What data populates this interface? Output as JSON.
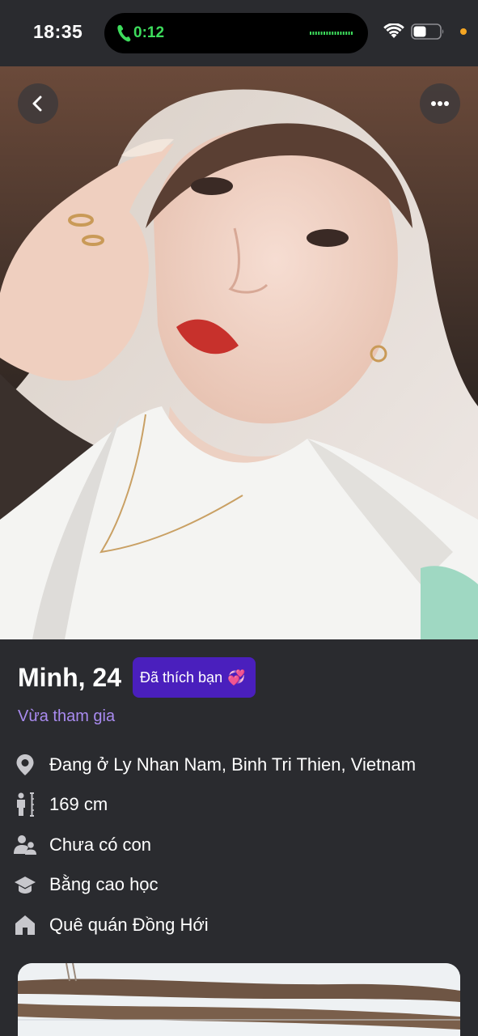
{
  "status_bar": {
    "time": "18:35",
    "call_timer": "0:12",
    "icons": [
      "phone-icon",
      "waveform-icon",
      "wifi-icon",
      "battery-icon"
    ],
    "privacy_dot_color": "#f5a623"
  },
  "photo": {
    "back_icon": "chevron-left-icon",
    "more_icon": "ellipsis-icon"
  },
  "profile": {
    "name_age": "Minh, 24",
    "liked_badge": "Đã thích bạn",
    "liked_badge_icon": "💞",
    "joined_label": "Vừa tham gia",
    "details": [
      {
        "icon": "location-pin-icon",
        "text": "Đang ở Ly Nhan Nam, Binh Tri Thien, Vietnam"
      },
      {
        "icon": "height-icon",
        "text": "169 cm"
      },
      {
        "icon": "family-icon",
        "text": "Chưa có con"
      },
      {
        "icon": "graduation-cap-icon",
        "text": "Bằng cao học"
      },
      {
        "icon": "home-icon",
        "text": "Quê quán Đồng Hới"
      }
    ]
  },
  "colors": {
    "background": "#2a2b2f",
    "accent_purple": "#4a1fbd",
    "joined_text": "#a98bf0",
    "call_green": "#3ddc5c"
  }
}
